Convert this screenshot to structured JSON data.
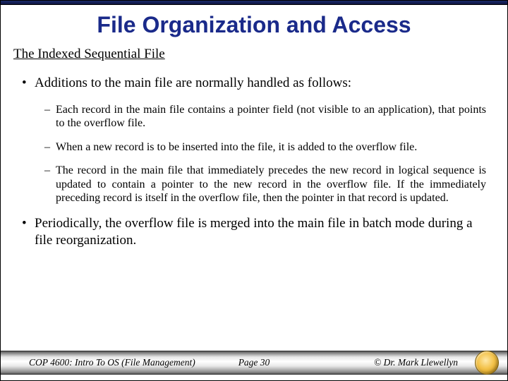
{
  "title": "File Organization and Access",
  "subtitle": "The Indexed Sequential File",
  "bullets": [
    {
      "text": "Additions to the main file are normally handled as follows:",
      "sub": [
        "Each record in the main file contains a pointer field (not visible to an application), that points to the overflow file.",
        "When a new record is to be inserted into the file, it is added to the overflow file.",
        "The record in the main file that immediately precedes the new record in logical sequence is updated to contain a pointer to the new record in the overflow file.  If the immediately preceding record is itself in the overflow file, then the pointer in that record is updated."
      ]
    },
    {
      "text": "Periodically, the overflow file is merged into the main file in batch mode during a file reorganization.",
      "sub": []
    }
  ],
  "footer": {
    "left": "COP 4600: Intro To OS  (File Management)",
    "center": "Page 30",
    "right": "© Dr. Mark Llewellyn"
  }
}
